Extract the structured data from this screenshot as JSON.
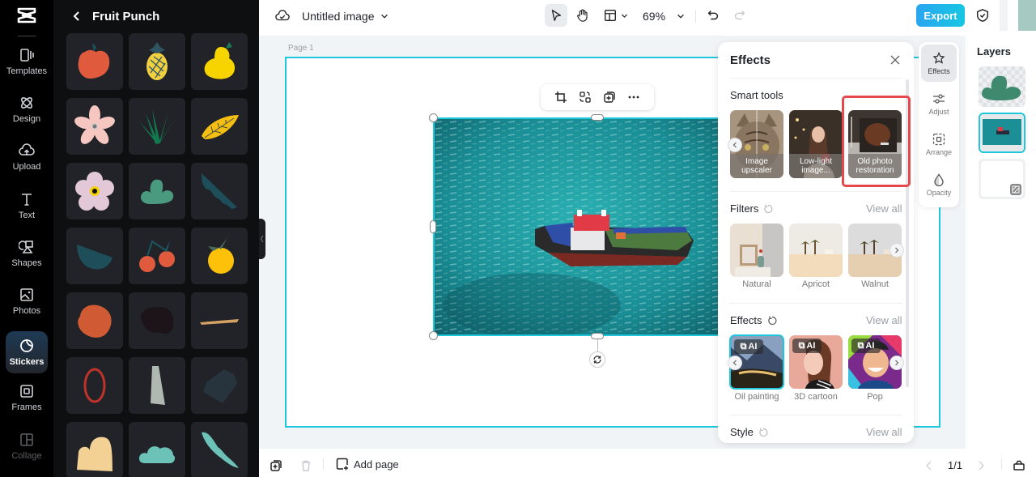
{
  "app": {
    "document_title": "Untitled image",
    "zoom_level": "69%",
    "export_label": "Export"
  },
  "rail": {
    "items": [
      {
        "label": "Templates",
        "icon": "templates-icon"
      },
      {
        "label": "Design",
        "icon": "design-icon"
      },
      {
        "label": "Upload",
        "icon": "upload-cloud-icon"
      },
      {
        "label": "Text",
        "icon": "text-icon"
      },
      {
        "label": "Shapes",
        "icon": "shapes-icon"
      },
      {
        "label": "Photos",
        "icon": "photos-icon"
      },
      {
        "label": "Stickers",
        "icon": "stickers-icon",
        "active": true
      },
      {
        "label": "Frames",
        "icon": "frames-icon"
      },
      {
        "label": "Collage",
        "icon": "collage-icon"
      }
    ]
  },
  "sticker_panel": {
    "title": "Fruit Punch",
    "stickers": [
      {
        "name": "apple",
        "color": "#e05a3d"
      },
      {
        "name": "pineapple",
        "color": "#f0d040"
      },
      {
        "name": "pear",
        "color": "#f7d400"
      },
      {
        "name": "pink-flower",
        "color": "#f6c6c0"
      },
      {
        "name": "green-leaves",
        "color": "#137a4f"
      },
      {
        "name": "yellow-leaf",
        "color": "#f5be12"
      },
      {
        "name": "lilac-flower",
        "color": "#e3c9d8"
      },
      {
        "name": "green-bush",
        "color": "#4a9a80"
      },
      {
        "name": "teal-diagonal-shape",
        "color": "#1d4e5a"
      },
      {
        "name": "teal-bowl-shape",
        "color": "#1d4e5a"
      },
      {
        "name": "cherries",
        "color": "#e05a3d"
      },
      {
        "name": "orange",
        "color": "#fec10a"
      },
      {
        "name": "orange-blob",
        "color": "#d05a33"
      },
      {
        "name": "dark-blob",
        "color": "#1c1418"
      },
      {
        "name": "tan-stroke",
        "color": "#d4a064"
      },
      {
        "name": "red-ring",
        "color": "#c0332a"
      },
      {
        "name": "grey-trapezoid",
        "color": "#b0b8b2"
      },
      {
        "name": "navy-shape",
        "color": "#27343e"
      },
      {
        "name": "cream-cloud-shape",
        "color": "#f3d195"
      },
      {
        "name": "mint-cloud",
        "color": "#6cc2b6"
      },
      {
        "name": "mint-leaf",
        "color": "#6cc2b6"
      }
    ]
  },
  "canvas": {
    "page_label": "Page 1",
    "accent_color": "#1fc7dc"
  },
  "effects_panel": {
    "title": "Effects",
    "smart_tools": {
      "title": "Smart tools",
      "items": [
        {
          "label_line1": "Image",
          "label_line2": "upscaler"
        },
        {
          "label_line1": "Low-light",
          "label_line2": "image..."
        },
        {
          "label_line1": "Old photo",
          "label_line2": "restoration",
          "highlighted": true
        }
      ]
    },
    "filters": {
      "title": "Filters",
      "view_all": "View all",
      "items": [
        "Natural",
        "Apricot",
        "Walnut"
      ]
    },
    "effects": {
      "title": "Effects",
      "view_all": "View all",
      "badge": "AI",
      "items": [
        {
          "label": "Oil painting",
          "selected": true
        },
        {
          "label": "3D cartoon"
        },
        {
          "label": "Pop"
        }
      ]
    },
    "style": {
      "title": "Style",
      "view_all": "View all"
    }
  },
  "property_tabs": [
    {
      "label": "Effects",
      "active": true
    },
    {
      "label": "Adjust"
    },
    {
      "label": "Arrange"
    },
    {
      "label": "Opacity"
    }
  ],
  "layers": {
    "title": "Layers"
  },
  "bottom": {
    "add_page_label": "Add page",
    "page_indicator": "1/1"
  }
}
